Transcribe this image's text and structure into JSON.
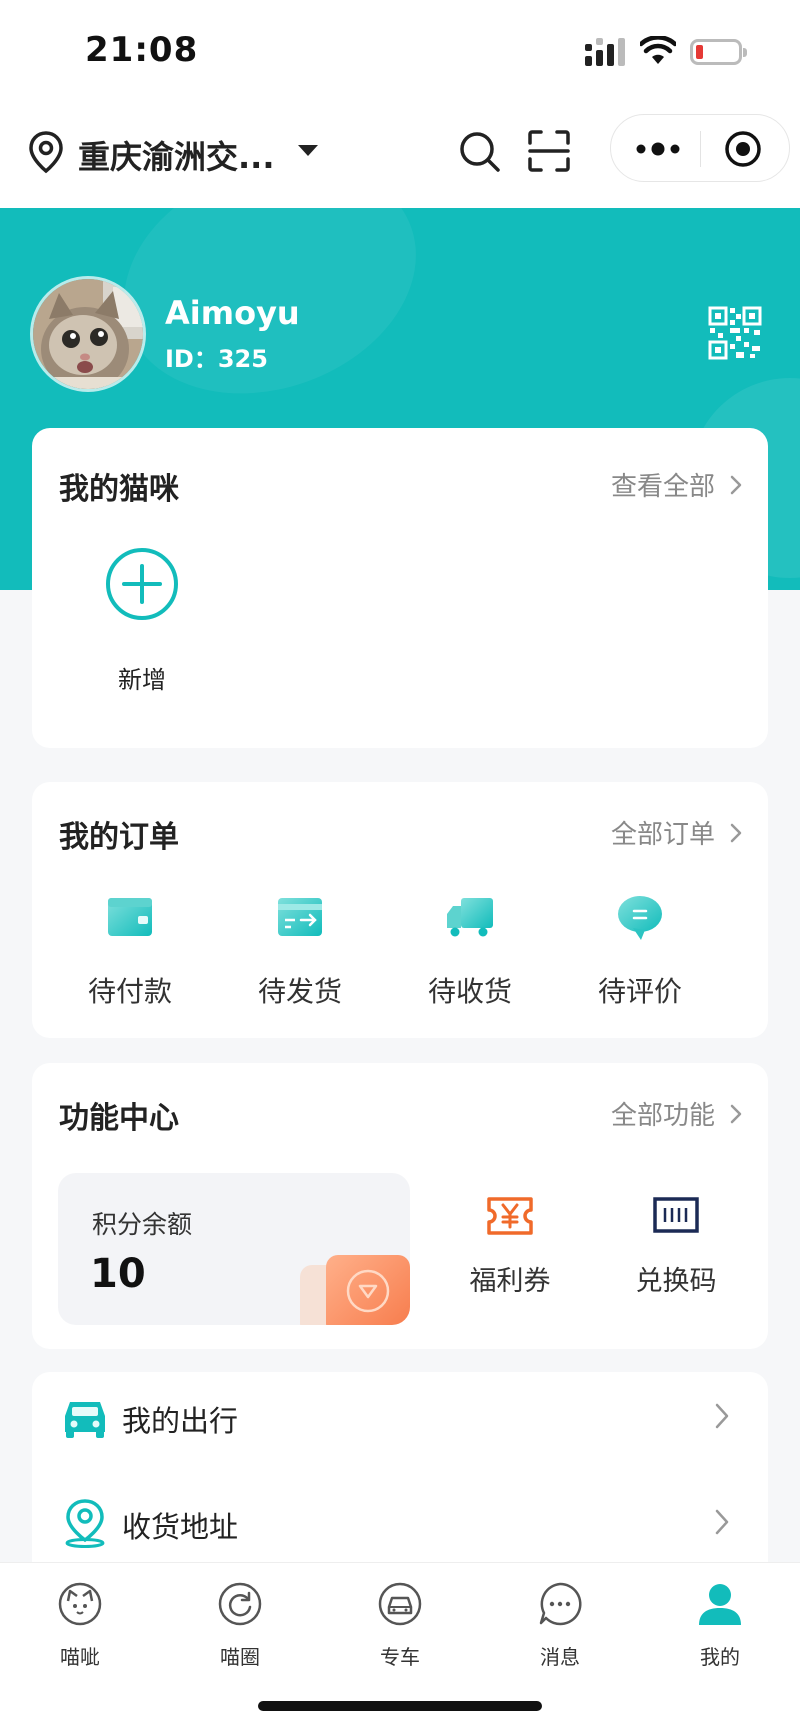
{
  "status_bar": {
    "time": "21:08"
  },
  "nav": {
    "location": "重庆渝洲交..."
  },
  "profile": {
    "name": "Aimoyu",
    "id_label": "ID：325"
  },
  "cats": {
    "title": "我的猫咪",
    "more": "查看全部",
    "add_label": "新增"
  },
  "orders": {
    "title": "我的订单",
    "more": "全部订单",
    "items": [
      {
        "label": "待付款",
        "icon": "wallet-icon"
      },
      {
        "label": "待发货",
        "icon": "card-arrow-icon"
      },
      {
        "label": "待收货",
        "icon": "truck-icon"
      },
      {
        "label": "待评价",
        "icon": "chat-bubble-icon"
      }
    ]
  },
  "functions": {
    "title": "功能中心",
    "more": "全部功能",
    "points_label": "积分余额",
    "points_value": "10",
    "items": [
      {
        "label": "福利券",
        "icon": "yen-coupon-icon"
      },
      {
        "label": "兑换码",
        "icon": "barcode-icon"
      }
    ]
  },
  "list": [
    {
      "label": "我的出行",
      "icon": "car-icon"
    },
    {
      "label": "收货地址",
      "icon": "location-pin-icon"
    }
  ],
  "tabs": [
    {
      "label": "喵呲",
      "icon": "cat-face-icon",
      "active": false
    },
    {
      "label": "喵圈",
      "icon": "circle-refresh-icon",
      "active": false
    },
    {
      "label": "专车",
      "icon": "car-icon",
      "active": false
    },
    {
      "label": "消息",
      "icon": "message-icon",
      "active": false
    },
    {
      "label": "我的",
      "icon": "user-icon",
      "active": true
    }
  ],
  "colors": {
    "accent": "#12bcbb",
    "active_tab": "#12bcbb",
    "coupon_orange": "#f06a2a",
    "battery_low": "#e53935"
  }
}
